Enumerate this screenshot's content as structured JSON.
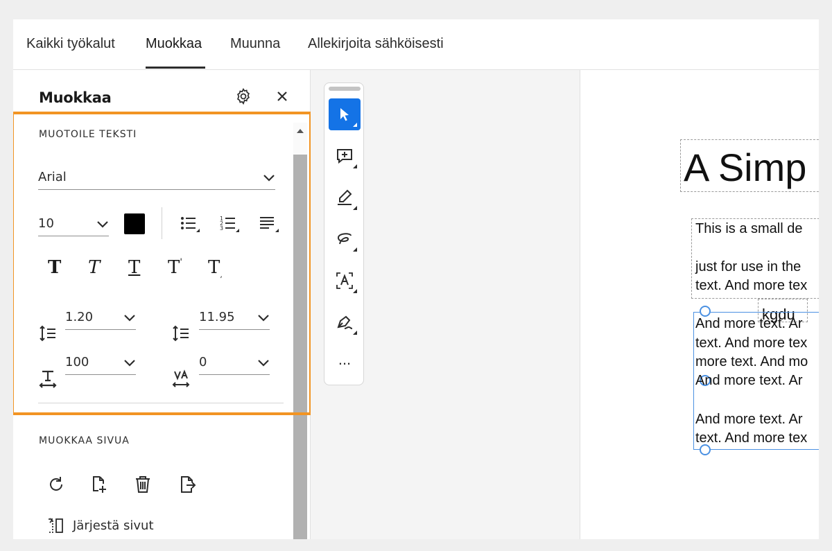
{
  "tabs": [
    {
      "label": "Kaikki työkalut"
    },
    {
      "label": "Muokkaa"
    },
    {
      "label": "Muunna"
    },
    {
      "label": "Allekirjoita sähköisesti"
    }
  ],
  "active_tab": "Muokkaa",
  "panel": {
    "title": "Muokkaa",
    "format_text": {
      "section_label": "MUOTOILE TEKSTI",
      "font": "Arial",
      "font_size": "10",
      "text_color": "#000000",
      "line_spacing": "1.20",
      "paragraph_spacing": "11.95",
      "horizontal_scale": "100",
      "char_spacing": "0"
    },
    "edit_page": {
      "section_label": "MUOKKAA SIVUA",
      "organize_label": "Järjestä sivut"
    }
  },
  "icons": [
    "settings-icon",
    "close-icon",
    "scroll-up-icon",
    "bullet-list-icon",
    "numbered-list-icon",
    "align-icon",
    "bold-icon",
    "italic-icon",
    "underline-icon",
    "superscript-icon",
    "subscript-icon",
    "line-spacing-icon",
    "paragraph-spacing-icon",
    "horizontal-scale-icon",
    "char-spacing-icon",
    "rotate-icon",
    "insert-page-icon",
    "delete-icon",
    "extract-icon",
    "organize-pages-icon",
    "select-icon",
    "add-comment-icon",
    "highlight-icon",
    "draw-icon",
    "text-recognition-icon",
    "sign-icon",
    "more-icon"
  ],
  "toolbar": {
    "more_label": "..."
  },
  "document": {
    "title": "A Simp",
    "para1_line1": "This is a small de",
    "para1_line2": "just for use in the",
    "para1_line3": "text. And more tex",
    "floating_text": "kgdu",
    "sel_line1": "And more text. Ar",
    "sel_line2": "text. And more tex",
    "sel_line3": "more text. And mo",
    "sel_line4": "And more text. Ar",
    "sel_line5": "And more text. Ar",
    "sel_line6": "text. And more tex"
  },
  "colors": {
    "accent": "#1473e6",
    "highlight": "#f29423",
    "selection": "#4a90e2"
  }
}
